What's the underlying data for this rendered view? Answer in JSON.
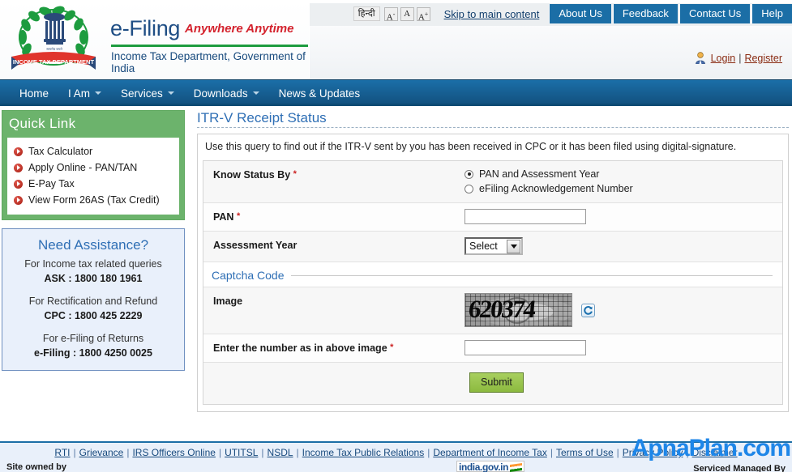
{
  "header": {
    "brand_title": "e-Filing",
    "brand_tagline": "Anywhere Anytime",
    "department_line": "Income Tax Department, Government of India",
    "emblem_ribbon_text": "INCOME TAX DEPARTMENT"
  },
  "topnav": {
    "hindi_label": "हिन्दी",
    "size_decrease": "A",
    "size_normal": "A",
    "size_increase": "A",
    "skip_link": "Skip to main content",
    "tabs": [
      {
        "label": "About Us"
      },
      {
        "label": "Feedback"
      },
      {
        "label": "Contact Us"
      },
      {
        "label": "Help"
      }
    ]
  },
  "account": {
    "login": "Login",
    "separator": "|",
    "register": "Register"
  },
  "mainnav": {
    "items": [
      {
        "label": "Home",
        "caret": false
      },
      {
        "label": "I Am",
        "caret": true
      },
      {
        "label": "Services",
        "caret": true
      },
      {
        "label": "Downloads",
        "caret": true
      },
      {
        "label": "News & Updates",
        "caret": false
      }
    ]
  },
  "quicklink": {
    "title": "Quick Link",
    "items": [
      {
        "label": "Tax Calculator"
      },
      {
        "label": "Apply Online - PAN/TAN"
      },
      {
        "label": "E-Pay Tax"
      },
      {
        "label": "View Form 26AS (Tax Credit)"
      }
    ]
  },
  "assistance": {
    "title": "Need Assistance?",
    "block1_text": "For Income tax related queries",
    "block1_number": "ASK : 1800 180 1961",
    "block2_text": "For Rectification and Refund",
    "block2_number": "CPC : 1800 425 2229",
    "block3_text": "For e-Filing of Returns",
    "block3_number": "e-Filing : 1800 4250 0025"
  },
  "main": {
    "page_title": "ITR-V Receipt Status",
    "description": "Use this query to find out if the ITR-V sent by you has been received in CPC or it has been filed using digital-signature.",
    "fields": {
      "know_status_by_label": "Know Status By",
      "know_status_required": "*",
      "radio_options": [
        {
          "label": "PAN and Assessment Year",
          "selected": true
        },
        {
          "label": "eFiling Acknowledgement Number",
          "selected": false
        }
      ],
      "pan_label": "PAN",
      "pan_required": "*",
      "pan_value": "",
      "pan_placeholder": "",
      "assessment_year_label": "Assessment Year",
      "assessment_year_value": "Select",
      "assessment_year_options": [
        "Select"
      ]
    },
    "captcha": {
      "section_label": "Captcha Code",
      "image_label": "Image",
      "image_text": "620374",
      "refresh_icon": "refresh-icon",
      "enter_label": "Enter the number as in above image",
      "enter_required": "*",
      "enter_value": "",
      "enter_placeholder": ""
    },
    "submit_label": "Submit"
  },
  "footer": {
    "links": [
      "RTI",
      "Grievance",
      "IRS Officers Online",
      "UTITSL",
      "NSDL",
      "Income Tax Public Relations",
      "Department of Income Tax",
      "Terms of Use",
      "Privacy Policy",
      "Disclaimer"
    ],
    "separator": "|",
    "site_owned_by": "Site owned by",
    "india_gov_label": "india.gov.in",
    "serviced_by": "Serviced  Managed By"
  },
  "watermark": {
    "text": "ApnaPlan.com",
    "color": "#1e86e8"
  },
  "colors": {
    "nav_blue": "#12507d",
    "tab_blue": "#1b6ea6",
    "brand_blue": "#1f4e85",
    "tagline_red": "#d4232e",
    "quicklink_green": "#6cb36c",
    "submit_green": "#8cba3f",
    "heading_blue": "#2f6fb5",
    "link_maroon": "#8a2b12"
  }
}
